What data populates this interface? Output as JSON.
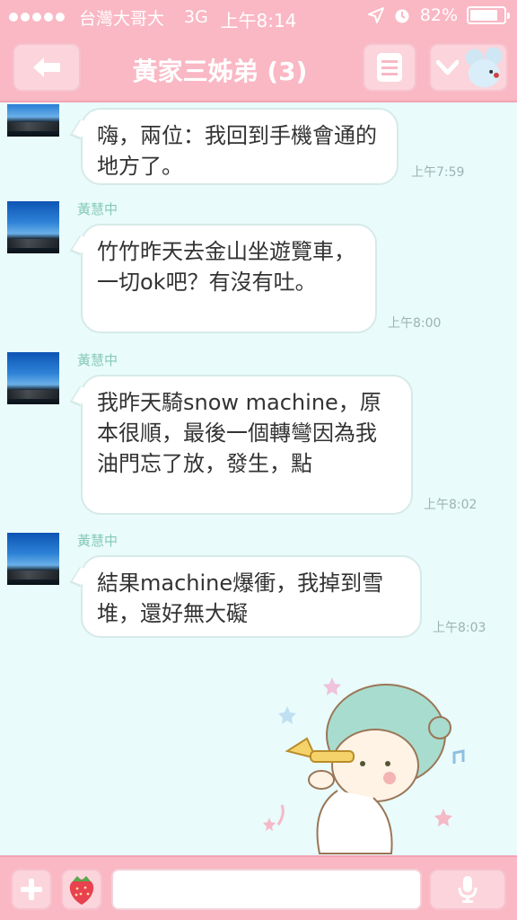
{
  "status_bar": {
    "carrier": "台灣大哥大",
    "network": "3G",
    "time": "上午8:14",
    "battery": "82%",
    "battery_level": 0.82
  },
  "header": {
    "title": "黃家三姊弟 (3)"
  },
  "messages": [
    {
      "sender": "",
      "text": "嗨，兩位：我回到手機會通的地方了。",
      "time": "上午7:59"
    },
    {
      "sender": "黃慧中",
      "text": "竹竹昨天去金山坐遊覽車，一切ok吧？有沒有吐。",
      "time": "上午8:00"
    },
    {
      "sender": "黃慧中",
      "text": "我昨天騎snow machine，原本很順，最後一個轉彎因為我油門忘了放，發生，點",
      "time": "上午8:02"
    },
    {
      "sender": "黃慧中",
      "text": "結果machine爆衝，我掉到雪堆，還好無大礙",
      "time": "上午8:03"
    }
  ],
  "input": {
    "placeholder": "",
    "value": ""
  },
  "colors": {
    "bar_pink": "#f9b8c4",
    "chat_bg": "#e9fbfb",
    "sender_green": "#85c9b7"
  }
}
